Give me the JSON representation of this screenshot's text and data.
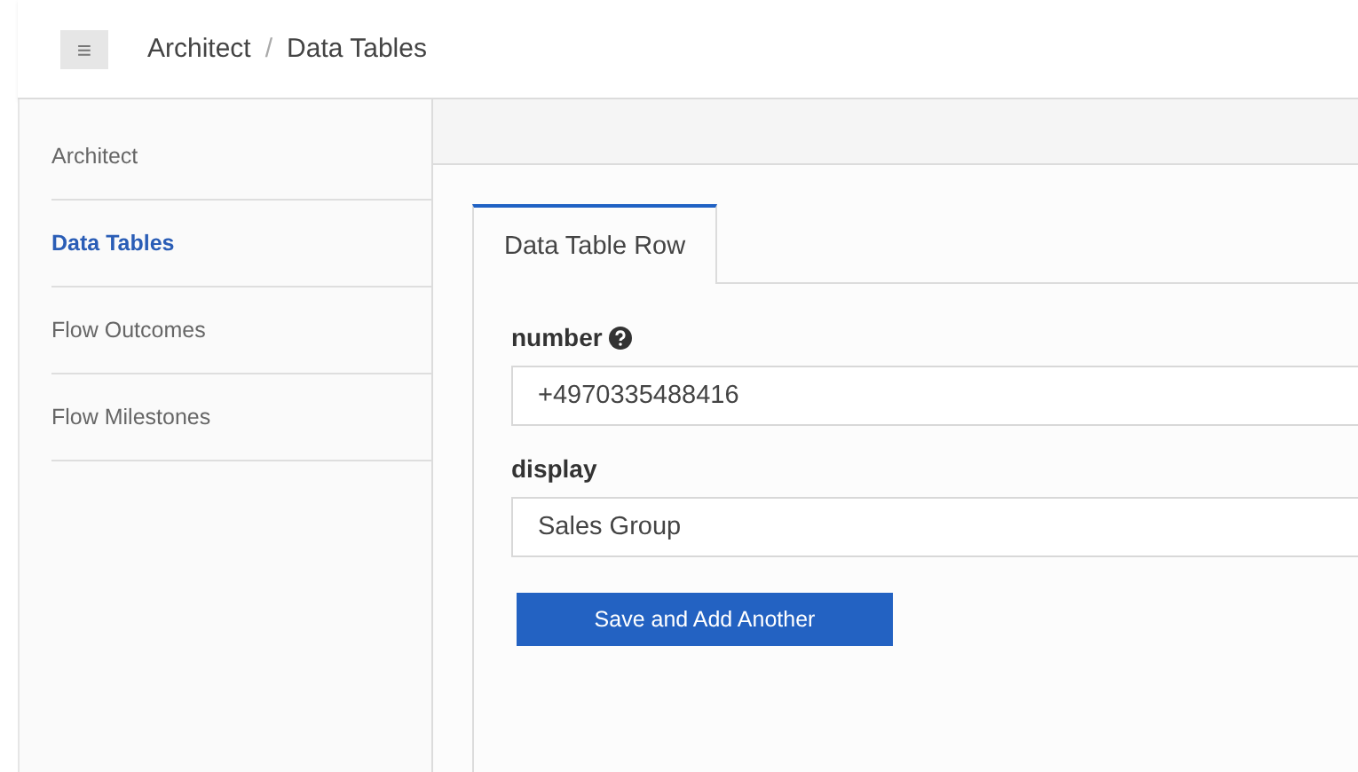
{
  "header": {
    "menu_button": "≡",
    "breadcrumbs": [
      "Architect",
      "Data Tables"
    ],
    "separator": "/"
  },
  "sidebar": {
    "items": [
      {
        "label": "Architect",
        "selected": false
      },
      {
        "label": "Data Tables",
        "selected": true
      },
      {
        "label": "Flow Outcomes",
        "selected": false
      },
      {
        "label": "Flow Milestones",
        "selected": false
      }
    ]
  },
  "tabs": [
    {
      "label": "Data Table Row",
      "selected": true
    }
  ],
  "fields": [
    {
      "label": "number",
      "help": true,
      "value": "+4970335488416"
    },
    {
      "label": "display",
      "help": false,
      "value": "Sales Group"
    }
  ],
  "buttons": [
    "Save and Add Another"
  ]
}
